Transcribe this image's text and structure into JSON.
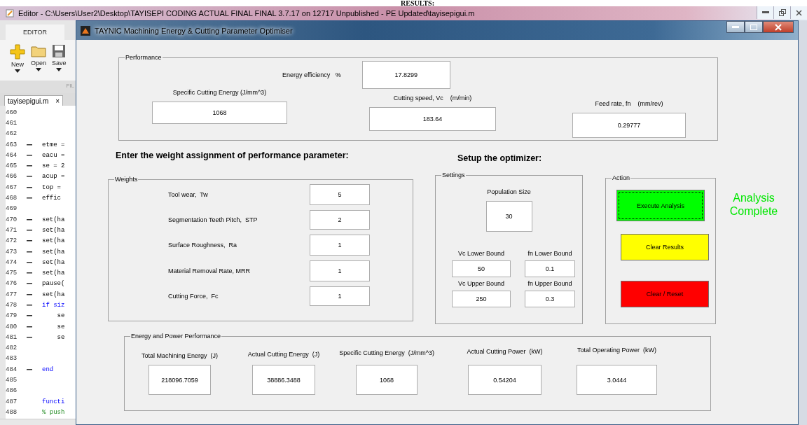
{
  "doc_heading": "RESULTS:",
  "editor": {
    "title": "Editor - C:\\Users\\User2\\Desktop\\TAYISEPI CODING ACTUAL FINAL FINAL 3.7.17 on 12717 Unpublished - PE Updated\\tayisepigui.m",
    "ribbon_tab": "EDITOR",
    "tools": [
      {
        "label": "New",
        "kind": "new"
      },
      {
        "label": "Open",
        "kind": "open"
      },
      {
        "label": "Save",
        "kind": "save"
      }
    ],
    "section_label": "FIL",
    "file_tab": {
      "label": "tayisepigui.m",
      "close": "×"
    },
    "lines": [
      {
        "number": "460",
        "executable": false
      },
      {
        "number": "461",
        "executable": false
      },
      {
        "number": "462",
        "executable": false
      },
      {
        "number": "463",
        "executable": true,
        "code": "etme =",
        "kind": "code"
      },
      {
        "number": "464",
        "executable": true,
        "code": "eacu =",
        "kind": "code"
      },
      {
        "number": "465",
        "executable": true,
        "code": "se = 2",
        "kind": "code"
      },
      {
        "number": "466",
        "executable": true,
        "code": "acup =",
        "kind": "code"
      },
      {
        "number": "467",
        "executable": true,
        "code": "top =",
        "kind": "code"
      },
      {
        "number": "468",
        "executable": true,
        "code": "effic",
        "kind": "code"
      },
      {
        "number": "469",
        "executable": false
      },
      {
        "number": "470",
        "executable": true,
        "code": "set(ha",
        "kind": "code"
      },
      {
        "number": "471",
        "executable": true,
        "code": "set(ha",
        "kind": "code"
      },
      {
        "number": "472",
        "executable": true,
        "code": "set(ha",
        "kind": "code"
      },
      {
        "number": "473",
        "executable": true,
        "code": "set(ha",
        "kind": "code"
      },
      {
        "number": "474",
        "executable": true,
        "code": "set(ha",
        "kind": "code"
      },
      {
        "number": "475",
        "executable": true,
        "code": "set(ha",
        "kind": "code"
      },
      {
        "number": "476",
        "executable": true,
        "code": "pause(",
        "kind": "code"
      },
      {
        "number": "477",
        "executable": true,
        "code": "set(ha",
        "kind": "code"
      },
      {
        "number": "478",
        "executable": true,
        "code": "if siz",
        "kind": "keyword"
      },
      {
        "number": "479",
        "executable": true,
        "code": "    se",
        "kind": "code"
      },
      {
        "number": "480",
        "executable": true,
        "code": "    se",
        "kind": "code"
      },
      {
        "number": "481",
        "executable": true,
        "code": "    se",
        "kind": "code"
      },
      {
        "number": "482",
        "executable": false
      },
      {
        "number": "483",
        "executable": false
      },
      {
        "number": "484",
        "executable": true,
        "code": "end",
        "kind": "keyword"
      },
      {
        "number": "485",
        "executable": false
      },
      {
        "number": "486",
        "executable": false
      },
      {
        "number": "487",
        "executable": false,
        "code": "functi",
        "kind": "keyword"
      },
      {
        "number": "488",
        "executable": false,
        "code": "% push",
        "kind": "comment"
      }
    ]
  },
  "dialog": {
    "title": "TAYNIC Machining Energy & Cutting Parameter Optimiser",
    "performance": {
      "title": "Performance",
      "efficiency": {
        "label": "Energy efficiency   %",
        "value": "17.8299"
      },
      "fields": [
        {
          "label": "Specific Cutting Energy (J/mm^3)",
          "value": "1068"
        },
        {
          "label": "Cutting speed, Vc    (m/min)",
          "value": "183.64"
        },
        {
          "label": "Feed rate, fn    (mm/rev)",
          "value": "0.29777"
        }
      ]
    },
    "weights_heading": "Enter the weight assignment of performance parameter:",
    "weights": {
      "title": "Weights",
      "rows": [
        {
          "label": "Tool wear,  Tw",
          "value": "5"
        },
        {
          "label": "Segmentation Teeth Pitch,  STP",
          "value": "2"
        },
        {
          "label": "Surface Roughness,  Ra",
          "value": "1"
        },
        {
          "label": "Material Removal Rate, MRR",
          "value": "1"
        },
        {
          "label": "Cutting Force,  Fc",
          "value": "1"
        }
      ]
    },
    "setup_heading": "Setup the optimizer:",
    "settings": {
      "title": "Settings",
      "population": {
        "label": "Population Size",
        "value": "30"
      },
      "bounds": [
        {
          "label": "Vc Lower Bound",
          "value": "50"
        },
        {
          "label": "fn Lower Bound",
          "value": "0.1"
        },
        {
          "label": "Vc Upper Bound",
          "value": "250"
        },
        {
          "label": "fn Upper Bound",
          "value": "0.3"
        }
      ]
    },
    "action": {
      "title": "Action",
      "buttons": [
        {
          "label": "Execute Analysis",
          "color": "#00ff00",
          "focused": true
        },
        {
          "label": "Clear Results",
          "color": "#ffff00",
          "focused": false
        },
        {
          "label": "Clear / Reset",
          "color": "#ff0000",
          "focused": false
        }
      ]
    },
    "status": "Analysis Complete",
    "energy": {
      "title": "Energy and Power Performance",
      "fields": [
        {
          "label": "Total Machining Energy  (J)",
          "value": "218096.7059"
        },
        {
          "label": "Actual Cutting Energy  (J)",
          "value": "38886.3488"
        },
        {
          "label": "Specific Cutting Energy  (J/mm^3)",
          "value": "1068"
        },
        {
          "label": "Actual Cutting Power  (kW)",
          "value": "0.54204"
        },
        {
          "label": "Total Operating Power  (kW)",
          "value": "3.0444"
        }
      ]
    }
  }
}
